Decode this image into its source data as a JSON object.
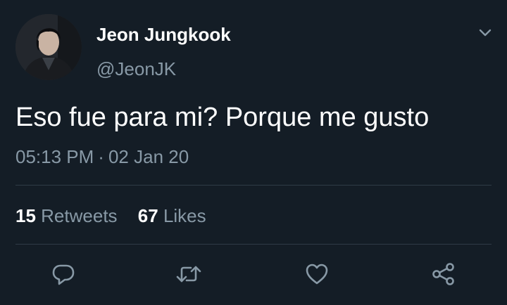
{
  "tweet": {
    "author": {
      "display_name": "Jeon Jungkook",
      "handle": "@JeonJK"
    },
    "text": "Eso fue para mi? Porque me gusto",
    "time": "05:13 PM",
    "separator": "·",
    "date": "02 Jan 20",
    "stats": {
      "retweets_count": "15",
      "retweets_label": "Retweets",
      "likes_count": "67",
      "likes_label": "Likes"
    }
  },
  "icons": {
    "menu": "chevron-down-icon",
    "reply": "reply-icon",
    "retweet": "retweet-icon",
    "like": "heart-icon",
    "share": "share-icon"
  },
  "colors": {
    "background": "#141d26",
    "primary_text": "#ffffff",
    "secondary_text": "#8899a6",
    "divider": "#2f3b47"
  }
}
